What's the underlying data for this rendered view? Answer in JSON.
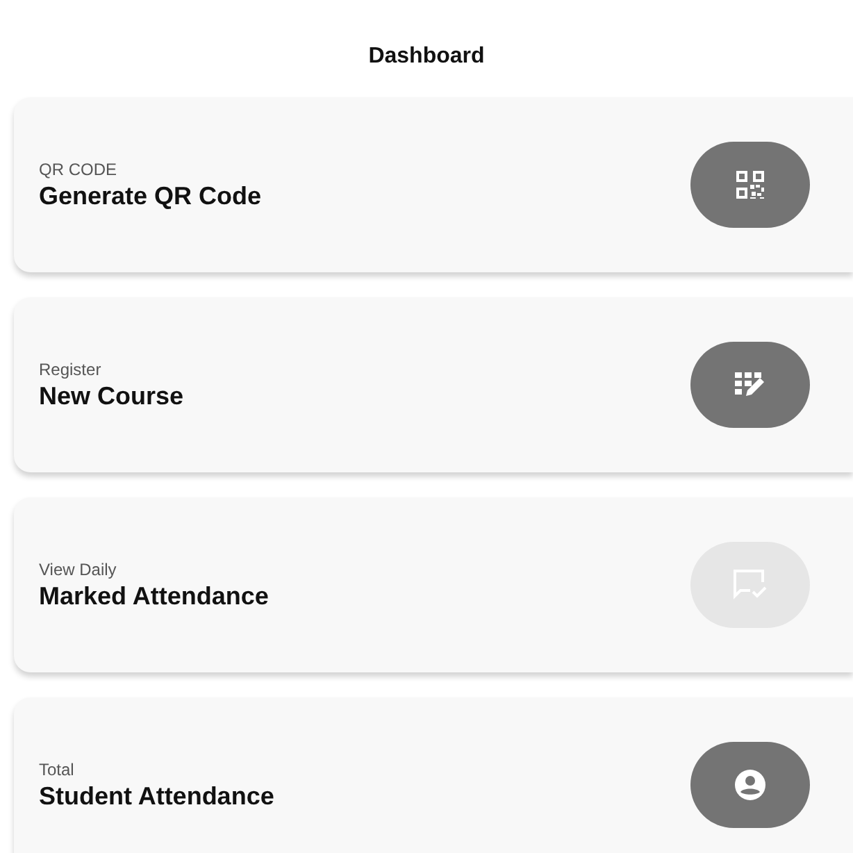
{
  "title": "Dashboard",
  "cards": [
    {
      "caption": "QR CODE",
      "label": "Generate QR Code",
      "kind": "qr",
      "disabled": false
    },
    {
      "caption": "Register",
      "label": "New Course",
      "kind": "grid-edit",
      "disabled": false
    },
    {
      "caption": "View Daily",
      "label": "Marked Attendance",
      "kind": "chat-check",
      "disabled": true
    },
    {
      "caption": "Total",
      "label": "Student Attendance",
      "kind": "account",
      "disabled": false
    }
  ]
}
